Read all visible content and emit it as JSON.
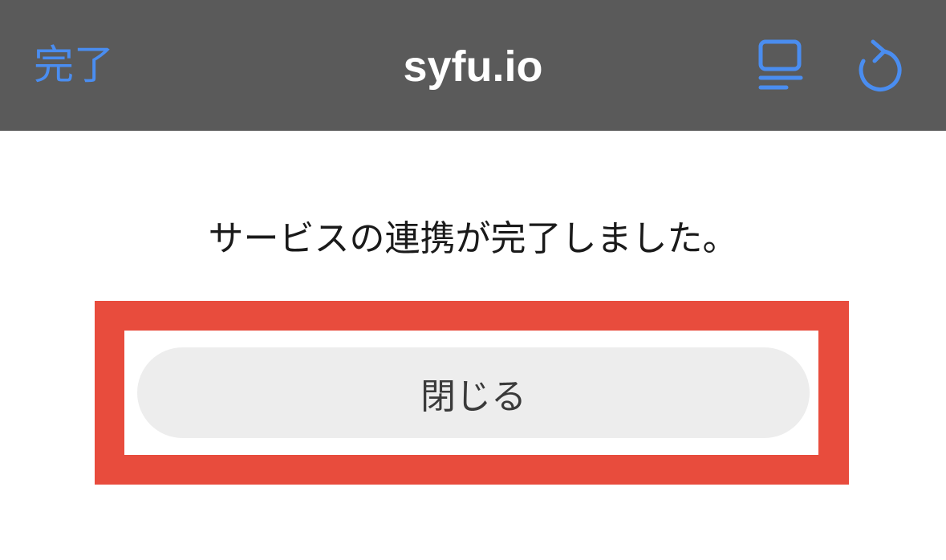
{
  "navbar": {
    "done_label": "完了",
    "title": "syfu.io",
    "reader_icon": "reader-view-icon",
    "reload_icon": "reload-icon",
    "background_color": "#5a5a5a",
    "accent_color": "#4a8df0"
  },
  "content": {
    "message": "サービスの連携が完了しました。",
    "close_button_label": "閉じる",
    "highlight_color": "#e84c3d"
  }
}
